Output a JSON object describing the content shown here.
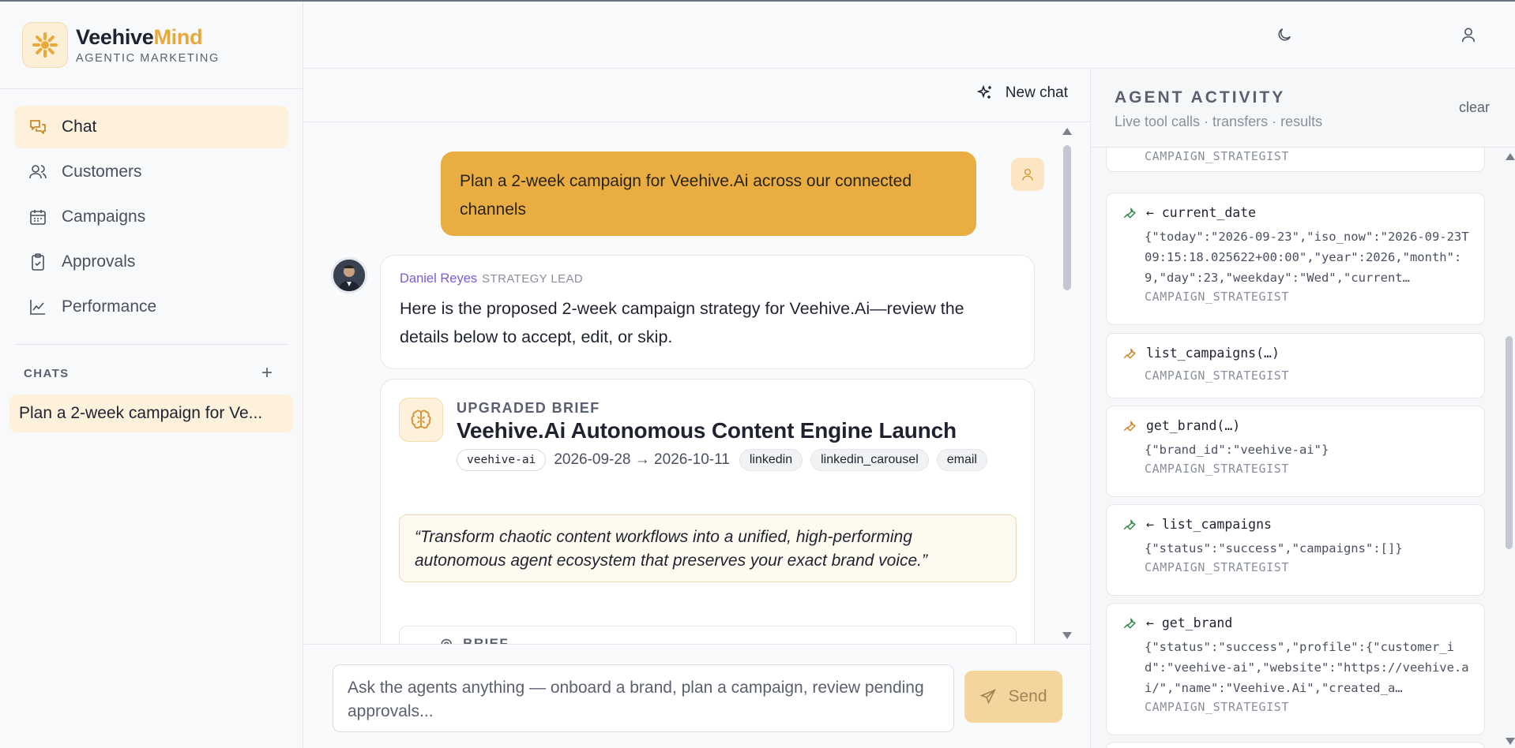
{
  "brand": {
    "name_part1": "Veehive",
    "name_part2": "Mind",
    "subtitle": "AGENTIC MARKETING"
  },
  "nav": [
    {
      "label": "Chat",
      "icon": "chat-icon",
      "active": true
    },
    {
      "label": "Customers",
      "icon": "users-icon"
    },
    {
      "label": "Campaigns",
      "icon": "calendar-icon"
    },
    {
      "label": "Approvals",
      "icon": "clipboard-check-icon"
    },
    {
      "label": "Performance",
      "icon": "line-chart-icon"
    }
  ],
  "chats": {
    "heading": "CHATS",
    "items": [
      {
        "label": "Plan a 2-week campaign for Ve..."
      }
    ]
  },
  "chat_header": {
    "new_chat_label": "New chat"
  },
  "conversation": {
    "user_message": "Plan a 2-week campaign for Veehive.Ai across our connected channels",
    "agent": {
      "name": "Daniel Reyes",
      "role": "STRATEGY LEAD",
      "message": "Here is the proposed 2-week campaign strategy for Veehive.Ai—review the details below to accept, edit, or skip."
    },
    "brief": {
      "kicker": "UPGRADED BRIEF",
      "title": "Veehive.Ai Autonomous Content Engine Launch",
      "brand_tag": "veehive-ai",
      "dates": "2026-09-28 → 2026-10-11",
      "channels": [
        "linkedin",
        "linkedin_carousel",
        "email"
      ],
      "quote": "“Transform chaotic content workflows into a unified, high-performing autonomous agent ecosystem that preserves your exact brand voice.”",
      "section_label": "BRIEF"
    }
  },
  "composer": {
    "placeholder": "Ask the agents anything — onboard a brand, plan a campaign, review pending approvals...",
    "send_label": "Send"
  },
  "activity": {
    "title": "AGENT ACTIVITY",
    "subtitle": "Live tool calls · transfers · results",
    "clear_label": "clear",
    "events": [
      {
        "kind": "partial",
        "agent": "CAMPAIGN_STRATEGIST"
      },
      {
        "kind": "result",
        "name": "← current_date",
        "body": "{\"today\":\"2026-09-23\",\"iso_now\":\"2026-09-23T09:15:18.025622+00:00\",\"year\":2026,\"month\":9,\"day\":23,\"weekday\":\"Wed\",\"current…",
        "agent": "CAMPAIGN_STRATEGIST"
      },
      {
        "kind": "call",
        "name": "list_campaigns(…)",
        "body": "",
        "agent": "CAMPAIGN_STRATEGIST"
      },
      {
        "kind": "call",
        "name": "get_brand(…)",
        "body": "{\"brand_id\":\"veehive-ai\"}",
        "agent": "CAMPAIGN_STRATEGIST"
      },
      {
        "kind": "result",
        "name": "← list_campaigns",
        "body": "{\"status\":\"success\",\"campaigns\":[]}",
        "agent": "CAMPAIGN_STRATEGIST"
      },
      {
        "kind": "result",
        "name": "← get_brand",
        "body": "{\"status\":\"success\",\"profile\":{\"customer_id\":\"veehive-ai\",\"website\":\"https://veehive.ai/\",\"name\":\"Veehive.Ai\",\"created_a…",
        "agent": "CAMPAIGN_STRATEGIST"
      }
    ]
  },
  "colors": {
    "accent": "#eaad42",
    "result_wrench": "#2f8a4a",
    "call_wrench": "#c9892a",
    "agent_name": "#7b5bd6"
  }
}
